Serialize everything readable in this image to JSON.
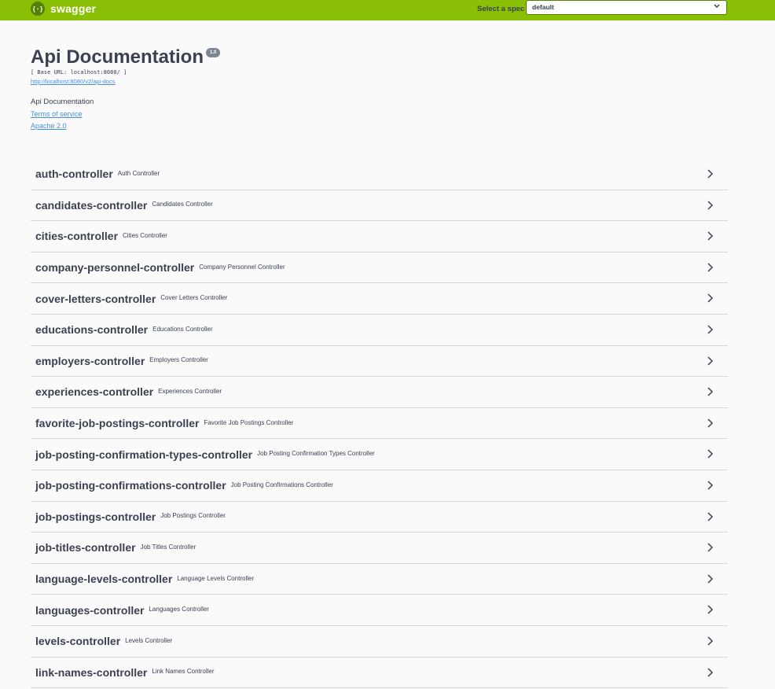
{
  "topbar": {
    "brand": "swagger",
    "spec_label": "Select a spec",
    "spec_value": "default"
  },
  "info": {
    "title": "Api Documentation",
    "version": "1.0",
    "base_url": "[ Base URL: localhost:8080/ ]",
    "docs_link": "http://localhost:8080/v2/api-docs",
    "description": "Api Documentation",
    "terms_link": "Terms of service",
    "license_link": "Apache 2.0"
  },
  "tags": [
    {
      "name": "auth-controller",
      "desc": "Auth Controller"
    },
    {
      "name": "candidates-controller",
      "desc": "Candidates Controller"
    },
    {
      "name": "cities-controller",
      "desc": "Cities Controller"
    },
    {
      "name": "company-personnel-controller",
      "desc": "Company Personnel Controller"
    },
    {
      "name": "cover-letters-controller",
      "desc": "Cover Letters Controller"
    },
    {
      "name": "educations-controller",
      "desc": "Educations Controller"
    },
    {
      "name": "employers-controller",
      "desc": "Employers Controller"
    },
    {
      "name": "experiences-controller",
      "desc": "Experiences Controller"
    },
    {
      "name": "favorite-job-postings-controller",
      "desc": "Favorite Job Postings Controller"
    },
    {
      "name": "job-posting-confirmation-types-controller",
      "desc": "Job Posting Confirmation Types Controller"
    },
    {
      "name": "job-posting-confirmations-controller",
      "desc": "Job Posting Confirmations Controller"
    },
    {
      "name": "job-postings-controller",
      "desc": "Job Postings Controller"
    },
    {
      "name": "job-titles-controller",
      "desc": "Job Titles Controller"
    },
    {
      "name": "language-levels-controller",
      "desc": "Language Levels Controller"
    },
    {
      "name": "languages-controller",
      "desc": "Languages Controller"
    },
    {
      "name": "levels-controller",
      "desc": "Levels Controller"
    },
    {
      "name": "link-names-controller",
      "desc": "Link Names Controller"
    }
  ],
  "colors": {
    "topbar": "#89bf04",
    "link": "#4990e2",
    "text": "#3b4151"
  },
  "icons": {
    "logo": "swagger-logo-icon",
    "select": "chevron-down-icon",
    "tag": "chevron-right-icon"
  }
}
